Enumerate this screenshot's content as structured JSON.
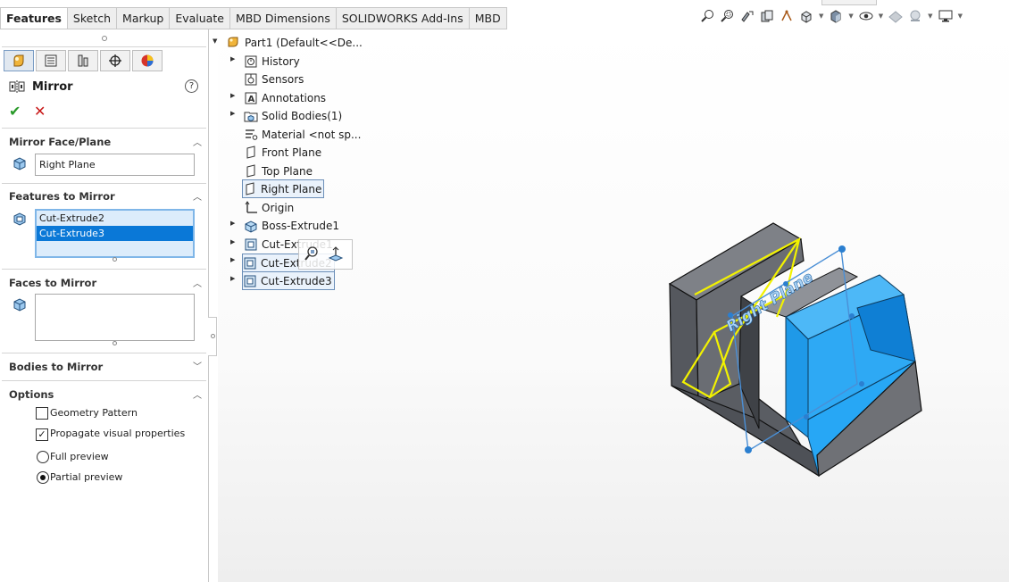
{
  "tabs": [
    "Features",
    "Sketch",
    "Markup",
    "Evaluate",
    "MBD Dimensions",
    "SOLIDWORKS Add-Ins",
    "MBD"
  ],
  "property_manager": {
    "title": "Mirror",
    "sections": {
      "mirror_face": {
        "title": "Mirror Face/Plane",
        "value": "Right Plane"
      },
      "features": {
        "title": "Features to Mirror",
        "items": [
          "Cut-Extrude2",
          "Cut-Extrude3"
        ],
        "selected_index": 1
      },
      "faces": {
        "title": "Faces to Mirror"
      },
      "bodies": {
        "title": "Bodies to Mirror"
      },
      "options": {
        "title": "Options",
        "geometry_pattern": {
          "label": "Geometry Pattern",
          "checked": false
        },
        "propagate": {
          "label": "Propagate visual properties",
          "checked": true
        },
        "full_preview": {
          "label": "Full preview",
          "selected": false
        },
        "partial_preview": {
          "label": "Partial preview",
          "selected": true
        }
      }
    }
  },
  "tree": {
    "root": "Part1  (Default<<De...",
    "items": {
      "history": "History",
      "sensors": "Sensors",
      "annotations": "Annotations",
      "solid_bodies": "Solid Bodies(1)",
      "material": "Material <not sp...",
      "front_plane": "Front Plane",
      "top_plane": "Top Plane",
      "right_plane": "Right Plane",
      "origin": "Origin",
      "boss_extrude1": "Boss-Extrude1",
      "cut_extrude1": "Cut-Extrude1",
      "cut_extrude2": "Cut-Extrude2",
      "cut_extrude3": "Cut-Extrude3"
    }
  },
  "viewport": {
    "plane_label": "Right Plane"
  },
  "colors": {
    "accent": "#0a78d7",
    "face_blue": "#27a7f5",
    "preview": "#f2f200",
    "body_gray": "#6f7176"
  }
}
